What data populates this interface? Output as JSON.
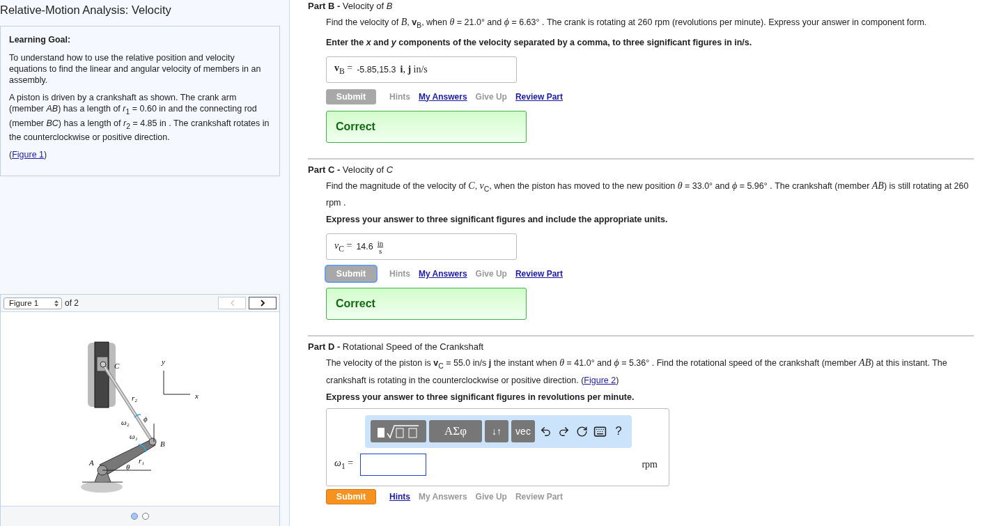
{
  "title": "Relative-Motion Analysis: Velocity",
  "learning_goal": {
    "heading": "Learning Goal:",
    "paragraphs": [
      "To understand how to use the relative position and velocity equations to find the linear and angular velocity of members in an assembly.",
      "A piston is driven by a crankshaft as shown. The crank arm (member *AB*) has a length of *r*$_{1}$ = 0.60 in and the connecting rod (member *BC*) has a length of *r*$_{2}$ = 4.85 in . The crankshaft rotates in the counterclockwise or positive direction."
    ],
    "figure_link": {
      "before": "(",
      "link": "Figure 1",
      "after": ")"
    }
  },
  "figure_viewer": {
    "selector": "Figure 1",
    "count": "of 2",
    "prev_enabled": false,
    "next_enabled": true,
    "labels": [
      "C",
      "y",
      "x",
      "r₂",
      "ω₂",
      "ϕ",
      "ω₁",
      "B",
      "A",
      "θ",
      "r₁"
    ],
    "pages": [
      {
        "selected": true
      },
      {
        "selected": false
      }
    ]
  },
  "parts": [
    {
      "heading": "**Part B -** Velocity of *B*",
      "divider": false,
      "question": "Find the velocity of *B*, **v**$_{B}$, when *θ* = 21.0° and *ϕ* = 6.63° . The crank is rotating at 260 rpm (revolutions per minute). Express your answer in component form.",
      "instruction": "Enter the *x* and *y* components of the velocity separated by a comma, to three significant figures in in/s.",
      "answer": {
        "kind": "filled",
        "label": "**v**$_{B}$ =",
        "value": "-5.85,15.3",
        "unit": "**i**, **j** in/s"
      },
      "submit": {
        "label": "Submit",
        "enabled": false,
        "focused": false
      },
      "links": [
        {
          "label": "Hints",
          "enabled": false
        },
        {
          "label": "My Answers",
          "enabled": true
        },
        {
          "label": "Give Up",
          "enabled": false
        },
        {
          "label": "Review Part",
          "enabled": true
        }
      ],
      "result": "Correct"
    },
    {
      "heading": "**Part C -** Velocity of *C*",
      "divider": true,
      "question": "Find the magnitude of the velocity of *C*, *v*$_{C}$, when the piston has moved to the new position *θ* = 33.0° and *ϕ* = 5.96° . The crankshaft (member *AB*) is still rotating at 260 rpm .",
      "instruction": "Express your answer to three significant figures and include the appropriate units.",
      "answer": {
        "kind": "fraction",
        "label": "*v*$_{C}$ =",
        "value": "14.6",
        "unit_num": "in",
        "unit_den": "s"
      },
      "submit": {
        "label": "Submit",
        "enabled": false,
        "focused": true
      },
      "links": [
        {
          "label": "Hints",
          "enabled": false
        },
        {
          "label": "My Answers",
          "enabled": true
        },
        {
          "label": "Give Up",
          "enabled": false
        },
        {
          "label": "Review Part",
          "enabled": true
        }
      ],
      "result": "Correct"
    },
    {
      "heading": "**Part D -** Rotational Speed of the Crankshaft",
      "divider": true,
      "question": "The velocity of the piston is **v**$_{C}$ = 55.0 in/s **j** the instant when *θ* = 41.0° and *ϕ* = 5.36° . Find the rotational speed of the crankshaft (member *AB*) at this instant. The crankshaft is rotating in the counterclockwise or positive direction.",
      "question_link": {
        "before": "(",
        "link": "Figure 2",
        "after": ")"
      },
      "instruction": "Express your answer to three significant figures in revolutions per minute.",
      "answer": {
        "kind": "editor",
        "label": "*ω*$_{1}$ =",
        "unit": "rpm",
        "toolbar": [
          {
            "kind": "templates"
          },
          {
            "kind": "text",
            "label": "ΑΣφ"
          },
          {
            "kind": "text",
            "label": "↓↑"
          },
          {
            "kind": "text",
            "label": "vec"
          },
          {
            "kind": "undo"
          },
          {
            "kind": "redo"
          },
          {
            "kind": "reset"
          },
          {
            "kind": "keyboard"
          },
          {
            "kind": "plain",
            "label": "?"
          }
        ]
      },
      "submit": {
        "label": "Submit",
        "enabled": true,
        "focused": false
      },
      "links": [
        {
          "label": "Hints",
          "enabled": true
        },
        {
          "label": "My Answers",
          "enabled": false
        },
        {
          "label": "Give Up",
          "enabled": false
        },
        {
          "label": "Review Part",
          "enabled": false
        }
      ]
    }
  ]
}
